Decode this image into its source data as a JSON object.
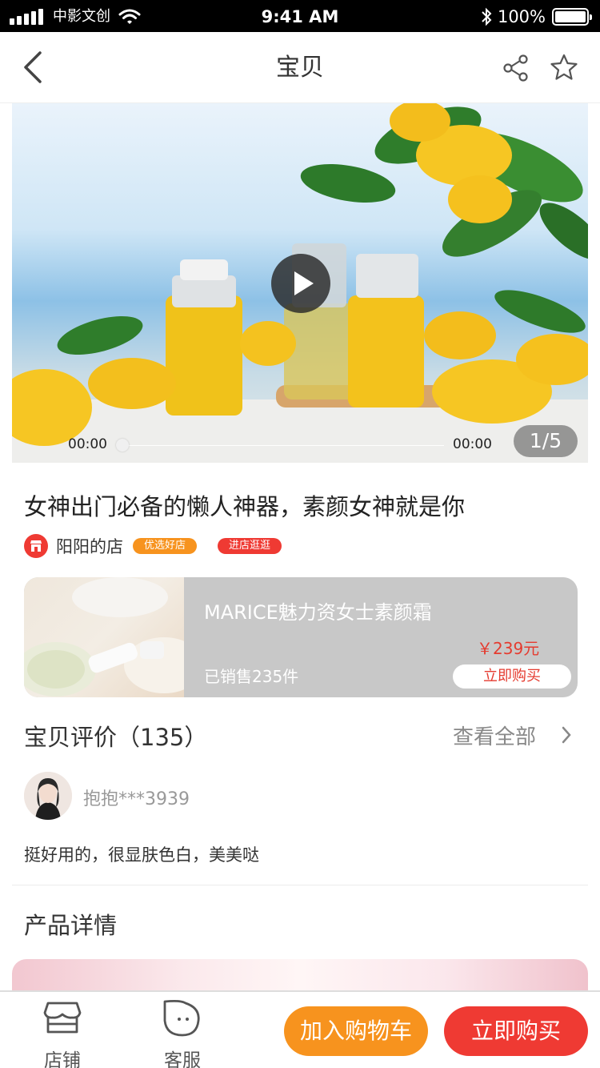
{
  "status_bar": {
    "carrier": "中影文创",
    "time": "9:41 AM",
    "battery": "100%",
    "icons": [
      "signal-icon",
      "wifi-icon",
      "bluetooth-icon",
      "battery-icon"
    ]
  },
  "nav": {
    "title": "宝贝",
    "icons": [
      "back-icon",
      "share-icon",
      "star-icon"
    ]
  },
  "media": {
    "current_time": "00:00",
    "duration": "00:00",
    "page_indicator": "1/5",
    "progress": 0
  },
  "product": {
    "title": "女神出门必备的懒人神器，素颜女神就是你",
    "shop_name": "阳阳的店",
    "tag_quality": "优选好店",
    "tag_visit": "进店逛逛"
  },
  "promo": {
    "name": "MARICE魅力资女士素颜霜",
    "price": "￥239元",
    "sold": "已销售235件",
    "buy_label": "立即购买"
  },
  "reviews": {
    "title": "宝贝评价（135）",
    "view_all": "查看全部",
    "user": "抱抱***3939",
    "text": "挺好用的，很显肤色白，美美哒"
  },
  "details": {
    "title": "产品详情"
  },
  "bottom_bar": {
    "store_label": "店铺",
    "service_label": "客服",
    "add_cart_label": "加入购物车",
    "buy_now_label": "立即购买"
  },
  "colors": {
    "accent_orange": "#f7931e",
    "accent_red": "#ef3a33",
    "price_red": "#e53b2f"
  }
}
